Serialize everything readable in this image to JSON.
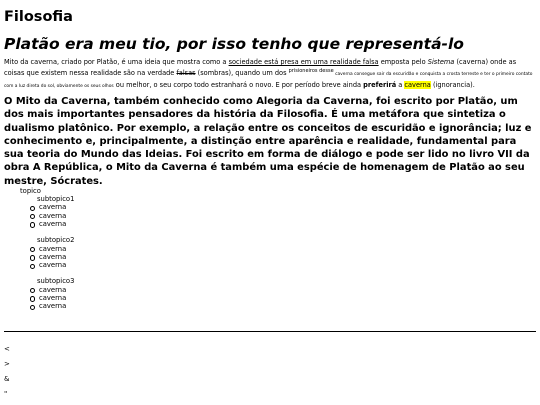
{
  "site_title": "Filosofia",
  "subtitle": "Platão era meu tio, por isso tenho que representá-lo",
  "intro": {
    "t1": "Mito da caverna, criado por Platão, é uma ideia que mostra como a ",
    "u1": "sociedade está presa em uma realidade falsa",
    "t2": " emposta pelo ",
    "em1": "Sistema",
    "t3": " (caverna) onde as coisas que existem nessa realidade são na verdade ",
    "del1": "falsas",
    "t4": " (sombras), quando um dos ",
    "sup1": "prisioneiros desse",
    "tiny1": " caverna consegue sair da escuridão e conquista a crosta terreste e ter o primeiro contato com a luz direta do sol, obviamente os seus olhos",
    "t5": " ou melhor, o seu corpo todo estranhará o novo. E por período breve ainda ",
    "b1": "preferirá",
    "t6": " a ",
    "mark1": "caverna",
    "t7": " (ignorancia)."
  },
  "lead_paragraph": "O Mito da Caverna, também conhecido como Alegoria da Caverna, foi escrito por Platão, um dos mais importantes pensadores da história da Filosofia. É uma metáfora que sintetiza o dualismo platônico. Por exemplo, a relação entre os conceitos de escuridão e ignorância; luz e conhecimento e, principalmente, a distinção entre aparência e realidade, fundamental para sua teoria do Mundo das Ideias. Foi escrito em forma de diálogo e pode ser lido no livro VII da obra A República, o Mito da Caverna é também uma espécie de homenagem de Platão ao seu mestre, Sócrates.",
  "tree": {
    "root": "topico",
    "groups": [
      {
        "title": "subtopico1",
        "items": [
          "caverna",
          "caverna",
          "caverna"
        ]
      },
      {
        "title": "subtopico2",
        "items": [
          "caverna",
          "caverna",
          "caverna"
        ]
      },
      {
        "title": "subtopico3",
        "items": [
          "caverna",
          "caverna",
          "caverna"
        ]
      }
    ]
  },
  "symbols": [
    "<",
    ">",
    "&",
    "\""
  ]
}
